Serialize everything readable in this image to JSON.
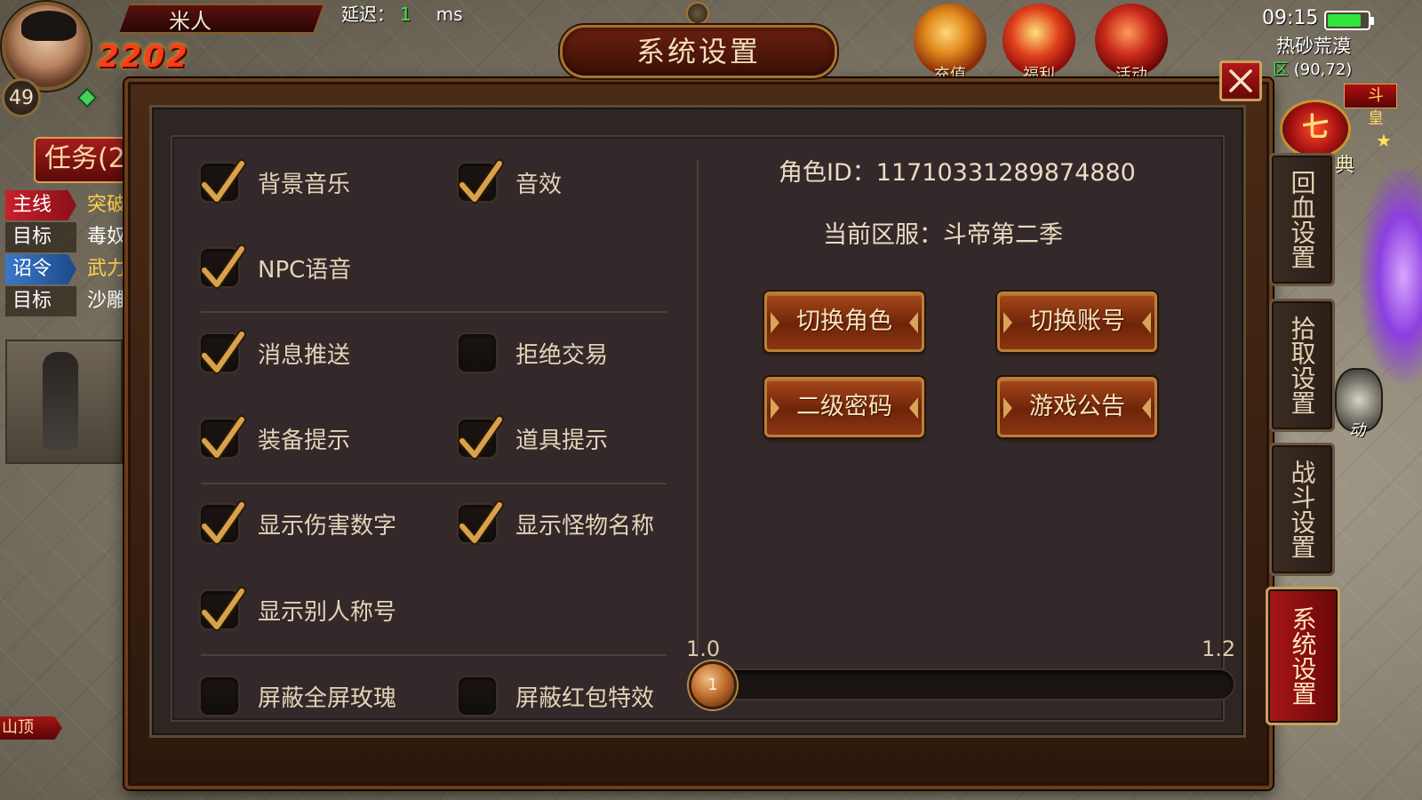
{
  "hud": {
    "player_name": "米人",
    "power_number": "2202",
    "level": "49",
    "latency_label": "延迟：",
    "latency_value": "1",
    "latency_unit": "ms",
    "clock": "09:15",
    "battery_percent": 85,
    "map_name": "热砂荒漠",
    "zone_char": "区",
    "coords": "(90,72)",
    "top_icons": [
      "充值",
      "福利",
      "活动"
    ],
    "right_ribbon": "斗皇",
    "seven_icon": "七",
    "dian_char": "典",
    "auto_label": "动"
  },
  "quest_panel": {
    "tab_label": "任务(2",
    "rows": [
      {
        "tag": "主线",
        "desc": "突破",
        "style": "main"
      },
      {
        "tag": "目标",
        "desc": "毒奴",
        "style": "goal"
      },
      {
        "tag": "诏令",
        "desc": "武力",
        "style": "edict"
      },
      {
        "tag": "目标",
        "desc": "沙雕",
        "style": "goal"
      }
    ],
    "location_label": "山顶"
  },
  "dialog": {
    "title": "系统设置",
    "options": [
      {
        "label": "背景音乐",
        "checked": true
      },
      {
        "label": "音效",
        "checked": true
      },
      {
        "label": "NPC语音",
        "checked": true
      },
      {
        "label": "消息推送",
        "checked": true
      },
      {
        "label": "拒绝交易",
        "checked": false
      },
      {
        "label": "装备提示",
        "checked": true
      },
      {
        "label": "道具提示",
        "checked": true
      },
      {
        "label": "显示伤害数字",
        "checked": true
      },
      {
        "label": "显示怪物名称",
        "checked": true
      },
      {
        "label": "显示别人称号",
        "checked": true
      },
      {
        "label": "屏蔽全屏玫瑰",
        "checked": false
      },
      {
        "label": "屏蔽红包特效",
        "checked": false
      }
    ],
    "role_id_label": "角色ID：",
    "role_id": "117103312898748​80",
    "server_label": "当前区服：",
    "server_name": "斗帝第二季",
    "buttons": {
      "switch_role": "切换角色",
      "switch_account": "切换账号",
      "second_password": "二级密码",
      "game_notice": "游戏公告"
    },
    "slider": {
      "min_label": "1.0",
      "max_label": "1.2",
      "thumb_label": "1",
      "value_fraction": 0.0
    }
  },
  "side_tabs": [
    {
      "label": "回血设置",
      "active": false
    },
    {
      "label": "拾取设置",
      "active": false
    },
    {
      "label": "战斗设置",
      "active": false
    },
    {
      "label": "系统设置",
      "active": true
    }
  ],
  "colors": {
    "check_gold": "#d9a24a",
    "accent_red": "#a81616",
    "panel_bg": "#33292a",
    "text": "#e3d4b8"
  }
}
